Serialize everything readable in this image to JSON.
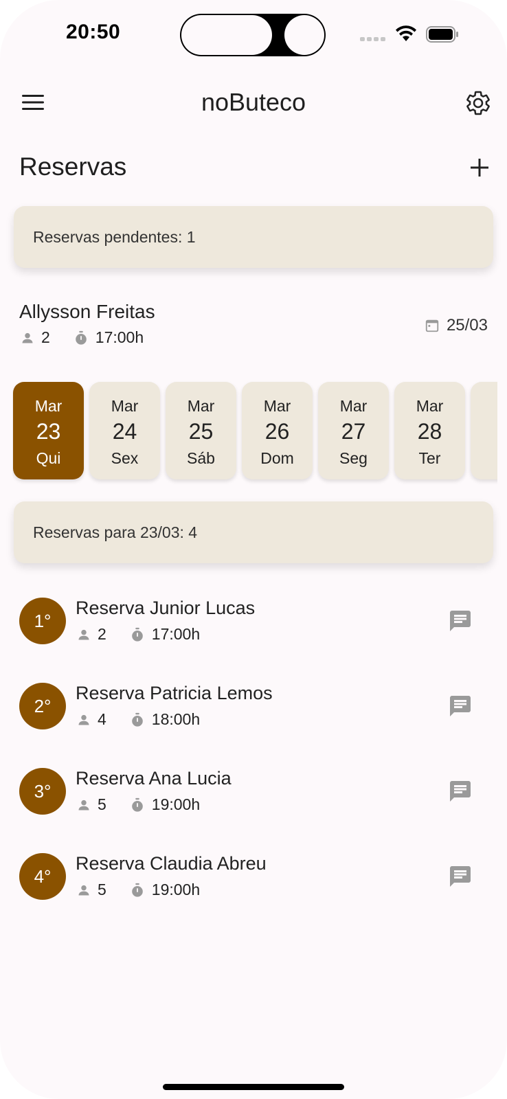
{
  "status_bar": {
    "time": "20:50"
  },
  "app_bar": {
    "title": "noButeco"
  },
  "page": {
    "title": "Reservas"
  },
  "pending": {
    "summary": "Reservas pendentes: 1",
    "item": {
      "name": "Allysson Freitas",
      "people": "2",
      "time": "17:00h",
      "date": "25/03"
    }
  },
  "dates": [
    {
      "month": "Mar",
      "day": "23",
      "weekday": "Qui",
      "selected": true
    },
    {
      "month": "Mar",
      "day": "24",
      "weekday": "Sex"
    },
    {
      "month": "Mar",
      "day": "25",
      "weekday": "Sáb"
    },
    {
      "month": "Mar",
      "day": "26",
      "weekday": "Dom"
    },
    {
      "month": "Mar",
      "day": "27",
      "weekday": "Seg"
    },
    {
      "month": "Mar",
      "day": "28",
      "weekday": "Ter"
    }
  ],
  "day_summary": "Reservas para 23/03: 4",
  "reservations": [
    {
      "rank": "1°",
      "name": "Reserva Junior Lucas",
      "people": "2",
      "time": "17:00h"
    },
    {
      "rank": "2°",
      "name": "Reserva Patricia Lemos",
      "people": "4",
      "time": "18:00h"
    },
    {
      "rank": "3°",
      "name": "Reserva Ana Lucia",
      "people": "5",
      "time": "19:00h"
    },
    {
      "rank": "4°",
      "name": "Reserva Claudia Abreu",
      "people": "5",
      "time": "19:00h"
    }
  ],
  "colors": {
    "accent": "#8a5200",
    "card": "#eee8dc",
    "background": "#fdf9fb"
  }
}
